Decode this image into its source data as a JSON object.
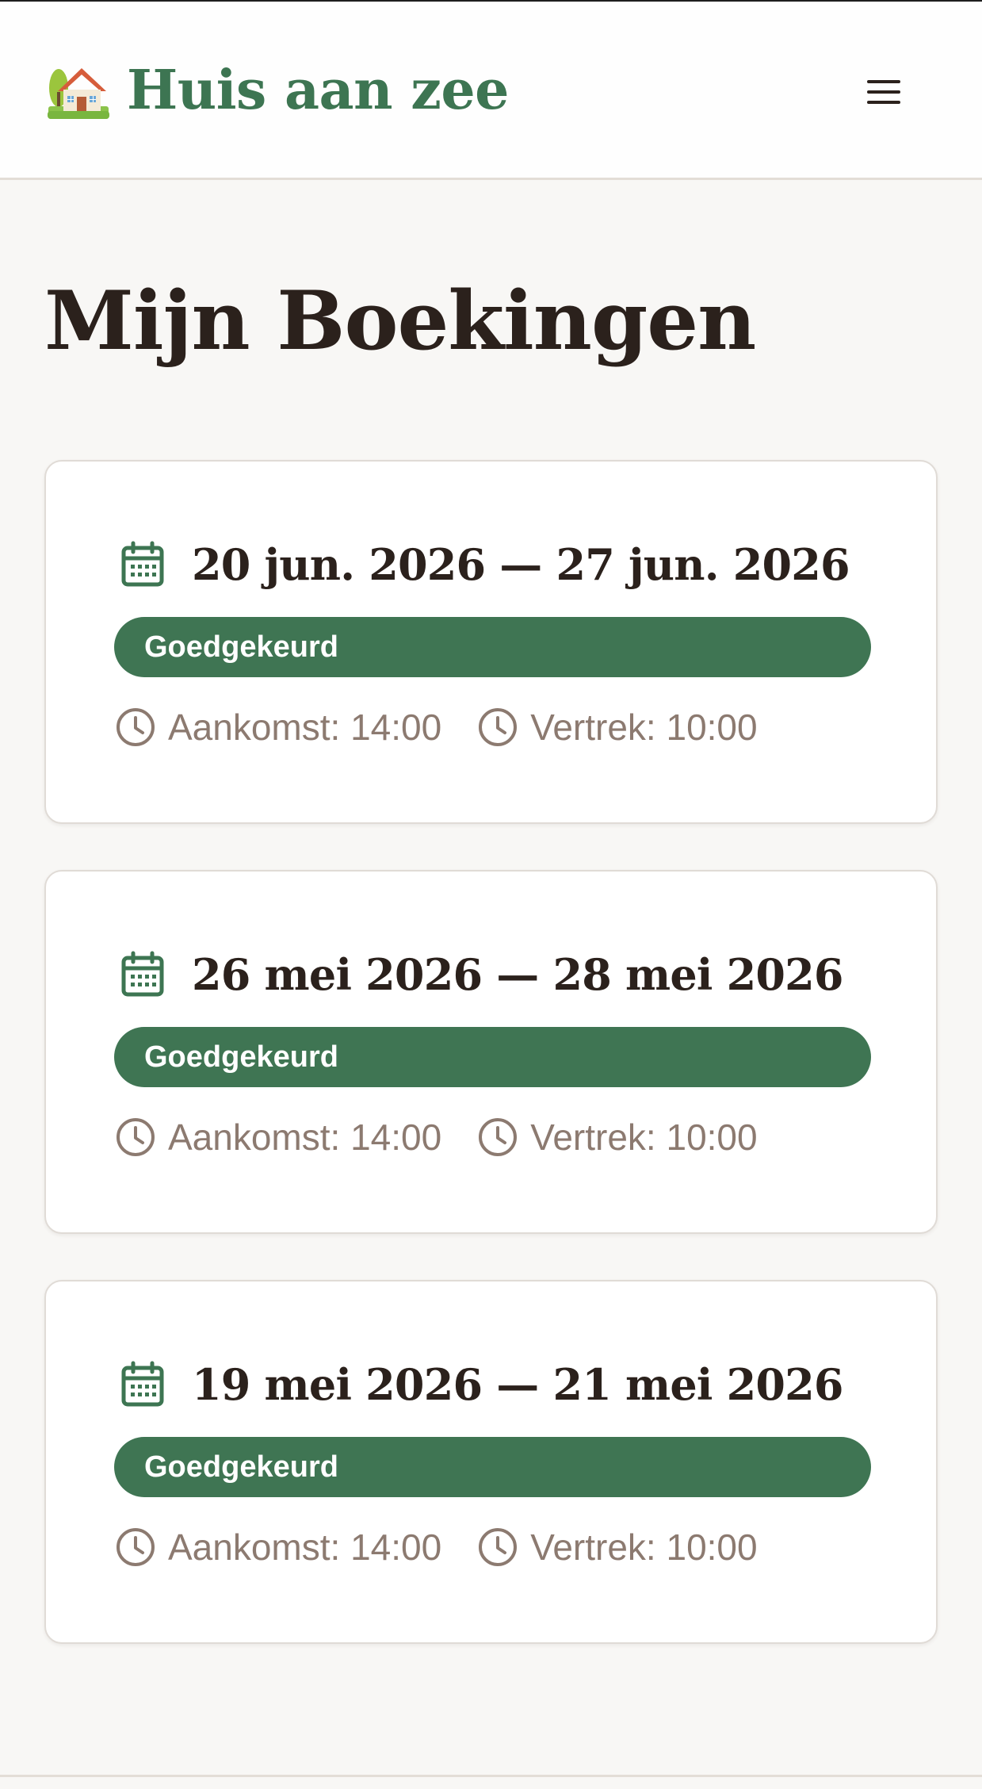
{
  "header": {
    "brand_title": "Huis aan zee",
    "logo_icon": "house-with-garden-icon",
    "menu_icon": "hamburger-menu-icon"
  },
  "page": {
    "title": "Mijn Boekingen"
  },
  "colors": {
    "brand_green": "#3d7552",
    "badge_green": "#3f7553",
    "text_dark": "#2b211c",
    "text_muted": "#8c7a70",
    "page_background": "#f8f7f5"
  },
  "bookings": [
    {
      "date_range": "20 jun. 2026 — 27 jun. 2026",
      "status": "Goedgekeurd",
      "arrival": "Aankomst: 14:00",
      "departure": "Vertrek: 10:00"
    },
    {
      "date_range": "26 mei 2026 — 28 mei 2026",
      "status": "Goedgekeurd",
      "arrival": "Aankomst: 14:00",
      "departure": "Vertrek: 10:00"
    },
    {
      "date_range": "19 mei 2026 — 21 mei 2026",
      "status": "Goedgekeurd",
      "arrival": "Aankomst: 14:00",
      "departure": "Vertrek: 10:00"
    }
  ]
}
